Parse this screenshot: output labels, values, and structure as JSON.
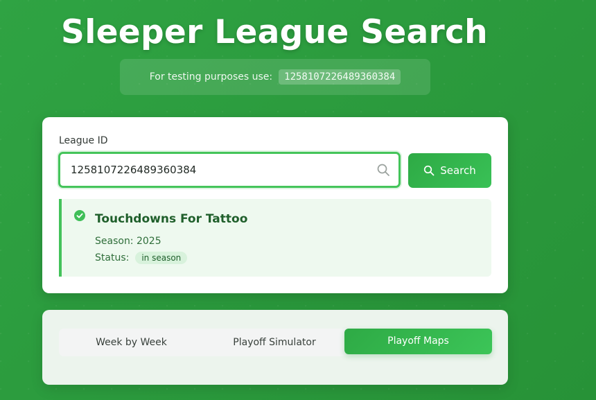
{
  "page": {
    "title": "Sleeper League Search"
  },
  "testing": {
    "label": "For testing purposes use:",
    "code": "1258107226489360384"
  },
  "search": {
    "label": "League ID",
    "value": "1258107226489360384",
    "button_label": "Search",
    "icon": "search-icon"
  },
  "result": {
    "status_icon": "check-circle-icon",
    "league_name": "Touchdowns For Tattoo",
    "season_label": "Season: 2025",
    "status_label": "Status:",
    "status_badge": "in season"
  },
  "tabs": [
    {
      "label": "Week by Week",
      "active": false
    },
    {
      "label": "Playoff Simulator",
      "active": false
    },
    {
      "label": "Playoff Maps",
      "active": true
    }
  ],
  "colors": {
    "background": "#2a9a3c",
    "accent": "#3cc156",
    "result_bg": "#eef9ef",
    "league_name": "#1f5f2b"
  }
}
